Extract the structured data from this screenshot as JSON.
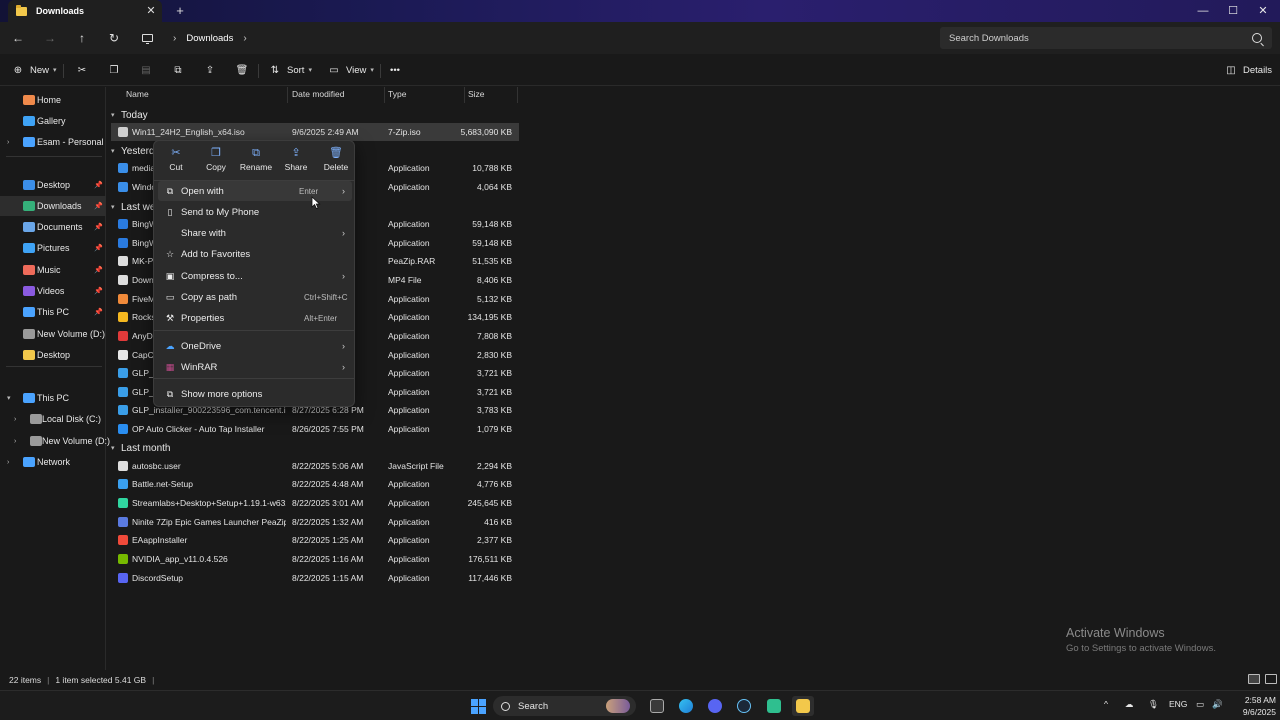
{
  "window": {
    "tab_title": "Downloads",
    "tab_close": "✕",
    "new_tab": "+",
    "minimize": "—",
    "maximize": "☐",
    "close": "✕"
  },
  "address": {
    "crumb": "Downloads",
    "search_placeholder": "Search Downloads"
  },
  "commands": {
    "new_label": "New",
    "sort_label": "Sort",
    "view_label": "View",
    "more": "•••",
    "details_label": "Details"
  },
  "sidebar": {
    "items": [
      {
        "label": "Home",
        "icon": "home-icon",
        "color": "#f08a4b"
      },
      {
        "label": "Gallery",
        "icon": "gallery-icon",
        "color": "#3fa3f5"
      },
      {
        "label": "Esam - Personal",
        "icon": "onedrive-icon",
        "color": "#4aa3ff"
      },
      {
        "label": "Desktop",
        "icon": "desktop-icon",
        "color": "#3b8ee8"
      },
      {
        "label": "Downloads",
        "icon": "downloads-icon",
        "color": "#35b07a"
      },
      {
        "label": "Documents",
        "icon": "documents-icon",
        "color": "#6aa6e8"
      },
      {
        "label": "Pictures",
        "icon": "pictures-icon",
        "color": "#3fa3f5"
      },
      {
        "label": "Music",
        "icon": "music-icon",
        "color": "#ef6b5a"
      },
      {
        "label": "Videos",
        "icon": "videos-icon",
        "color": "#8a5ae0"
      },
      {
        "label": "This PC",
        "icon": "this-pc-icon",
        "color": "#4aa3ff"
      },
      {
        "label": "New Volume (D:)",
        "icon": "drive-icon",
        "color": "#9a9a9a"
      },
      {
        "label": "Desktop",
        "icon": "folder-icon",
        "color": "#f2c84b"
      },
      {
        "label": "This PC",
        "icon": "this-pc-icon",
        "color": "#4aa3ff"
      },
      {
        "label": "Local Disk (C:)",
        "icon": "drive-icon",
        "color": "#9a9a9a"
      },
      {
        "label": "New Volume (D:)",
        "icon": "drive-icon",
        "color": "#9a9a9a"
      },
      {
        "label": "Network",
        "icon": "network-icon",
        "color": "#4aa3ff"
      }
    ]
  },
  "columns": {
    "name": "Name",
    "date": "Date modified",
    "type": "Type",
    "size": "Size"
  },
  "groups": {
    "today": "Today",
    "yesterday": "Yesterday",
    "last_week": "Last week",
    "last_month": "Last month"
  },
  "files": [
    {
      "name": "Win11_24H2_English_x64.iso",
      "date": "9/6/2025 2:49 AM",
      "type": "7-Zip.iso",
      "size": "5,683,090 KB",
      "color": "#cfcfcf"
    },
    {
      "name": "media",
      "date": "",
      "type": "Application",
      "size": "10,788 KB",
      "color": "#3a8ee8"
    },
    {
      "name": "Windo",
      "date": "",
      "type": "Application",
      "size": "4,064 KB",
      "color": "#3a8ee8"
    },
    {
      "name": "BingW",
      "date": "M",
      "type": "Application",
      "size": "59,148 KB",
      "color": "#2a7be0"
    },
    {
      "name": "BingW",
      "date": "M",
      "type": "Application",
      "size": "59,148 KB",
      "color": "#2a7be0"
    },
    {
      "name": "MK-P",
      "date": "",
      "type": "PeaZip.RAR",
      "size": "51,535 KB",
      "color": "#dddddd"
    },
    {
      "name": "Down",
      "date": "",
      "type": "MP4 File",
      "size": "8,406 KB",
      "color": "#dddddd"
    },
    {
      "name": "FiveM",
      "date": "",
      "type": "Application",
      "size": "5,132 KB",
      "color": "#f08a3a"
    },
    {
      "name": "Rocks",
      "date": "",
      "type": "Application",
      "size": "134,195 KB",
      "color": "#f5b820"
    },
    {
      "name": "AnyD",
      "date": "",
      "type": "Application",
      "size": "7,808 KB",
      "color": "#e03a3a"
    },
    {
      "name": "CapC",
      "date": "M",
      "type": "Application",
      "size": "2,830 KB",
      "color": "#e8e8e8"
    },
    {
      "name": "GLP_i",
      "date": "",
      "type": "Application",
      "size": "3,721 KB",
      "color": "#3a9ee8"
    },
    {
      "name": "GLP_i",
      "date": "",
      "type": "Application",
      "size": "3,721 KB",
      "color": "#3a9ee8"
    },
    {
      "name": "GLP_installer_900223596_com.tencent.ig",
      "date": "8/27/2025 6:28 PM",
      "type": "Application",
      "size": "3,783 KB",
      "color": "#3a9ee8"
    },
    {
      "name": "OP Auto Clicker - Auto Tap Installer",
      "date": "8/26/2025 7:55 PM",
      "type": "Application",
      "size": "1,079 KB",
      "color": "#2a8ef0"
    },
    {
      "name": "autosbc.user",
      "date": "8/22/2025 5:06 AM",
      "type": "JavaScript File",
      "size": "2,294 KB",
      "color": "#dddddd"
    },
    {
      "name": "Battle.net-Setup",
      "date": "8/22/2025 4:48 AM",
      "type": "Application",
      "size": "4,776 KB",
      "color": "#3aa0f0"
    },
    {
      "name": "Streamlabs+Desktop+Setup+1.19.1-w632...",
      "date": "8/22/2025 3:01 AM",
      "type": "Application",
      "size": "245,645 KB",
      "color": "#30d6a0"
    },
    {
      "name": "Ninite 7Zip Epic Games Launcher PeaZip ...",
      "date": "8/22/2025 1:32 AM",
      "type": "Application",
      "size": "416 KB",
      "color": "#5a7ae0"
    },
    {
      "name": "EAappInstaller",
      "date": "8/22/2025 1:25 AM",
      "type": "Application",
      "size": "2,377 KB",
      "color": "#f04a3a"
    },
    {
      "name": "NVIDIA_app_v11.0.4.526",
      "date": "8/22/2025 1:16 AM",
      "type": "Application",
      "size": "176,511 KB",
      "color": "#76b900"
    },
    {
      "name": "DiscordSetup",
      "date": "8/22/2025 1:15 AM",
      "type": "Application",
      "size": "117,446 KB",
      "color": "#5865f2"
    }
  ],
  "context_menu": {
    "quick_actions": [
      {
        "label": "Cut",
        "icon": "cut-icon"
      },
      {
        "label": "Copy",
        "icon": "copy-icon"
      },
      {
        "label": "Rename",
        "icon": "rename-icon"
      },
      {
        "label": "Share",
        "icon": "share-icon"
      },
      {
        "label": "Delete",
        "icon": "delete-icon"
      }
    ],
    "items": [
      {
        "label": "Open with",
        "shortcut": "Enter",
        "submenu": true,
        "icon": "open-with-icon"
      },
      {
        "label": "Send to My Phone",
        "shortcut": "",
        "submenu": false,
        "icon": "phone-icon"
      },
      {
        "label": "Share with",
        "shortcut": "",
        "submenu": true,
        "icon": ""
      },
      {
        "label": "Add to Favorites",
        "shortcut": "",
        "submenu": false,
        "icon": "star-icon"
      },
      {
        "label": "Compress to...",
        "shortcut": "",
        "submenu": true,
        "icon": "compress-icon"
      },
      {
        "label": "Copy as path",
        "shortcut": "Ctrl+Shift+C",
        "submenu": false,
        "icon": "path-icon"
      },
      {
        "label": "Properties",
        "shortcut": "Alt+Enter",
        "submenu": false,
        "icon": "wrench-icon"
      },
      {
        "label": "OneDrive",
        "shortcut": "",
        "submenu": true,
        "icon": "onedrive-icon"
      },
      {
        "label": "WinRAR",
        "shortcut": "",
        "submenu": true,
        "icon": "winrar-icon"
      },
      {
        "label": "Show more options",
        "shortcut": "",
        "submenu": false,
        "icon": "more-options-icon"
      }
    ]
  },
  "watermark": {
    "title": "Activate Windows",
    "subtitle": "Go to Settings to activate Windows."
  },
  "status": {
    "count": "22 items",
    "selection": "1 item selected  5.41 GB"
  },
  "taskbar": {
    "search_label": "Search",
    "lang": "ENG",
    "time": "2:58 AM",
    "date": "9/6/2025"
  },
  "colors": {
    "accent": "#4aa3ff",
    "selection": "#3a3a3a",
    "menu_bg": "#2b2b2b"
  }
}
